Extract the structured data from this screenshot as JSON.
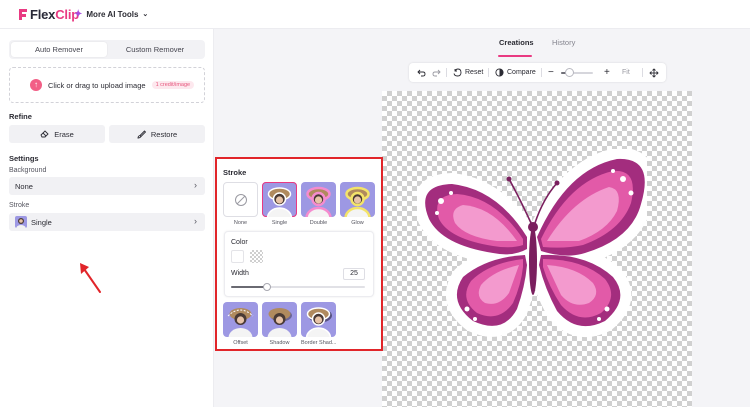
{
  "header": {
    "logo_text_a": "Flex",
    "logo_text_b": "Clip",
    "more_tools_label": "More AI Tools"
  },
  "left_panel": {
    "tabs": [
      {
        "label": "Auto Remover",
        "active": true
      },
      {
        "label": "Custom Remover",
        "active": false
      }
    ],
    "upload": {
      "label": "Click or drag to upload image",
      "credit": "1 credit/image"
    },
    "refine": {
      "title": "Refine",
      "erase_label": "Erase",
      "restore_label": "Restore"
    },
    "settings": {
      "title": "Settings",
      "background_label": "Background",
      "background_value": "None",
      "stroke_label": "Stroke",
      "stroke_value": "Single"
    }
  },
  "view_tabs": [
    {
      "label": "Creations",
      "active": true
    },
    {
      "label": "History",
      "active": false
    }
  ],
  "toolbar": {
    "reset_label": "Reset",
    "compare_label": "Compare",
    "fit_label": "Fit",
    "zoom_level": 0.25
  },
  "stroke_popup": {
    "title": "Stroke",
    "options": [
      {
        "label": "None",
        "selected": false
      },
      {
        "label": "Single",
        "selected": true
      },
      {
        "label": "Double",
        "selected": false
      },
      {
        "label": "Glow",
        "selected": false
      },
      {
        "label": "Offset",
        "selected": false
      },
      {
        "label": "Shadow",
        "selected": false
      },
      {
        "label": "Border Shad...",
        "selected": false
      }
    ],
    "color_label": "Color",
    "width_label": "Width",
    "width_value": "25",
    "width_level": 0.27
  },
  "colors": {
    "accent": "#e93a82",
    "highlight_border": "#e1252a",
    "thumb_bg": "#9d98e3",
    "butterfly_main": "#d4459e"
  }
}
